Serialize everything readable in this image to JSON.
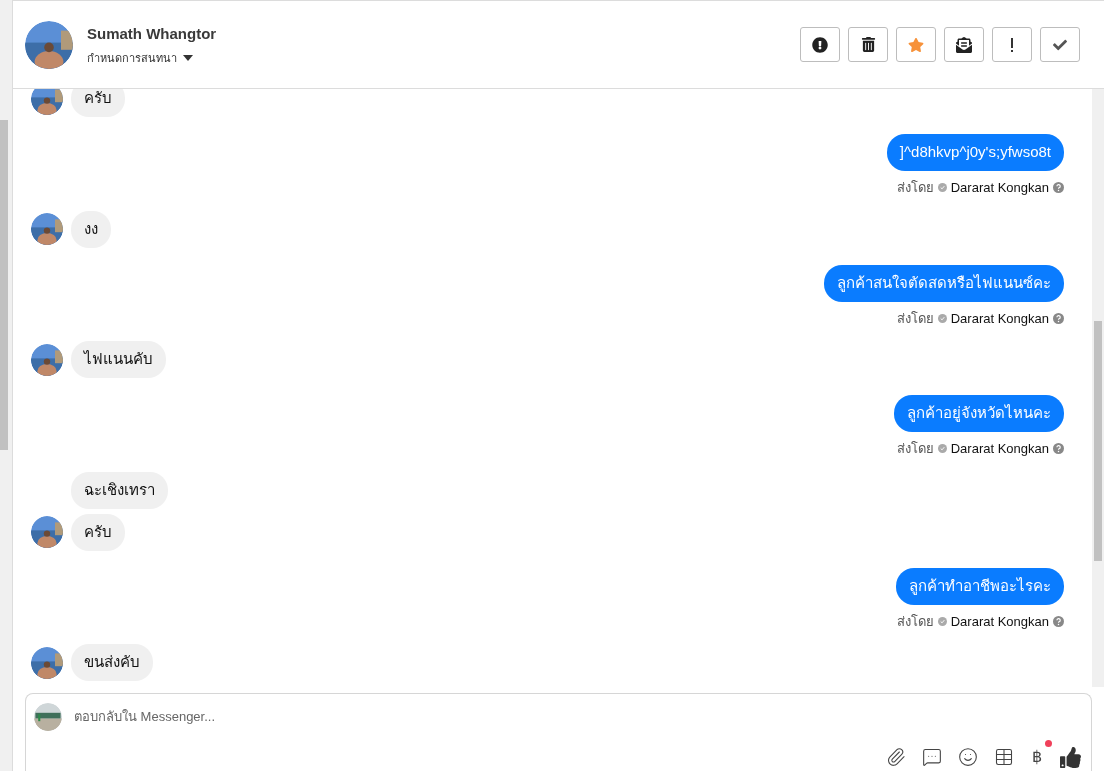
{
  "header": {
    "name": "Sumath Whangtor",
    "subtitle": "กำหนดการสนทนา"
  },
  "messages": [
    {
      "kind": "incoming",
      "text": "ครับ",
      "avatar": true
    },
    {
      "kind": "outgoing",
      "text": "]^d8hkvp^j0y's;yfwso8t",
      "sent_by": "ส่งโดย",
      "sender": "Dararat Kongkan"
    },
    {
      "kind": "incoming",
      "text": "งง",
      "avatar": true
    },
    {
      "kind": "outgoing",
      "text": "ลูกค้าสนใจตัดสดหรือไฟแนนซ์คะ",
      "sent_by": "ส่งโดย",
      "sender": "Dararat Kongkan"
    },
    {
      "kind": "incoming",
      "text": "ไฟแนนคับ",
      "avatar": true
    },
    {
      "kind": "outgoing",
      "text": "ลูกค้าอยู่จังหวัดไหนคะ",
      "sent_by": "ส่งโดย",
      "sender": "Dararat Kongkan"
    },
    {
      "kind": "incoming",
      "text": "ฉะเชิงเทรา",
      "avatar": false
    },
    {
      "kind": "incoming",
      "text": "ครับ",
      "avatar": true
    },
    {
      "kind": "outgoing",
      "text": "ลูกค้าทำอาชีพอะไรคะ",
      "sent_by": "ส่งโดย",
      "sender": "Dararat Kongkan"
    },
    {
      "kind": "incoming",
      "text": "ขนส่งคับ",
      "avatar": true
    }
  ],
  "composer": {
    "placeholder": "ตอบกลับใน Messenger...",
    "currency": "฿",
    "currency_badge": true
  }
}
